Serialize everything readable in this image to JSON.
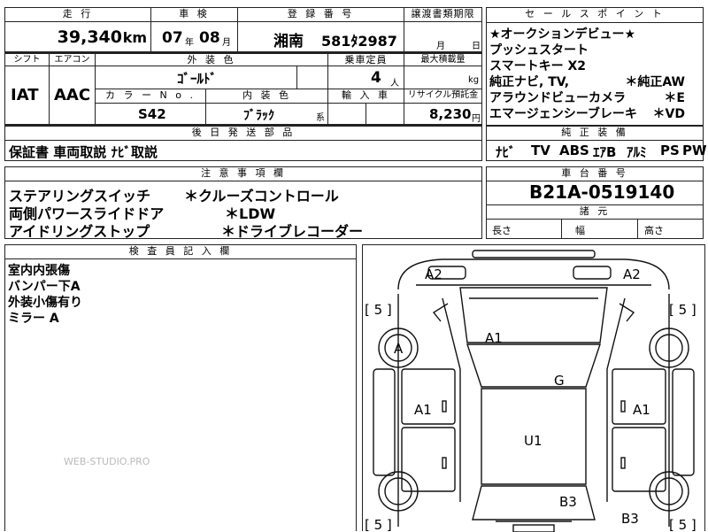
{
  "top": {
    "h_mileage": "走 行",
    "mileage": "39,340",
    "mileage_unit": "km",
    "h_inspection": "車 検",
    "insp_year": "07",
    "insp_year_unit": "年",
    "insp_month": "08",
    "insp_month_unit": "月",
    "h_registration": "登 録 番 号",
    "reg_region": "湘南",
    "reg_number": "581ﾀ2987",
    "h_transfer": "譲渡書類期限",
    "transfer_month": "月",
    "transfer_day": "日",
    "h_selling": "セ ー ル ス ポ イ ン ト"
  },
  "row2": {
    "h_shift": "シフト",
    "shift": "IAT",
    "h_aircon": "エアコン",
    "aircon": "AAC",
    "h_exterior": "外 装 色",
    "exterior_color": "ｺﾞｰﾙﾄﾞ",
    "h_capacity": "乗車定員",
    "capacity": "4",
    "capacity_unit": "人",
    "h_maxload": "最大積載量",
    "maxload_unit": "kg",
    "h_colorno": "カ ラ ー N o .",
    "color_no": "S42",
    "h_interior": "内 装 色",
    "interior_color": "ﾌﾞﾗｯｸ",
    "interior_suffix": "系",
    "h_import": "輸 入 車",
    "h_recycle": "リサイクル預託金",
    "recycle": "8,230",
    "recycle_unit": "円"
  },
  "sales_points": [
    "★オークションデビュー★",
    "プッシュスタート",
    "スマートキー X2",
    "純正ナビ, TV,",
    "アラウンドビューカメラ",
    "エマージェンシーブレーキ"
  ],
  "sales_points_right": [
    "＊純正AW",
    "＊E",
    "＊VD"
  ],
  "later_parts": {
    "header": "後 日 発 送 部 品",
    "text": "保証書 車両取説 ﾅﾋﾞ取説"
  },
  "equipment": {
    "header": "純 正 装 備",
    "items": [
      "ﾅﾋﾞ",
      "TV",
      "ABS",
      "ｴｱB",
      "ｱﾙﾐ",
      "PS",
      "PW"
    ]
  },
  "notes": {
    "header": "注 意 事 項 欄",
    "lines": [
      {
        "left": "ステアリングスイッチ",
        "right": "＊クルーズコントロール"
      },
      {
        "left": "両側パワースライドドア",
        "right": "＊LDW"
      },
      {
        "left": "アイドリングストップ",
        "right": "＊ドライブレコーダー"
      }
    ]
  },
  "chassis": {
    "header": "車 台 番 号",
    "number": "B21A-0519140"
  },
  "specs": {
    "header": "諸 元",
    "length": "長さ",
    "width": "幅",
    "height": "高さ"
  },
  "inspector": {
    "header": "検 査 員 記 入 欄",
    "lines": [
      "室内内張傷",
      "バンパー下A",
      "外装小傷有り",
      "ミラー A"
    ]
  },
  "watermark": "WEB-STUDIO.PRO",
  "diagram": {
    "labels": [
      "A2",
      "A2",
      "A1",
      "A",
      "G",
      "A1",
      "A1",
      "U1",
      "B3",
      "B3"
    ],
    "tire_marks": [
      "[ 5 ]",
      "[ 5 ]",
      "[ 5 ]",
      "[ 5 ]"
    ]
  }
}
